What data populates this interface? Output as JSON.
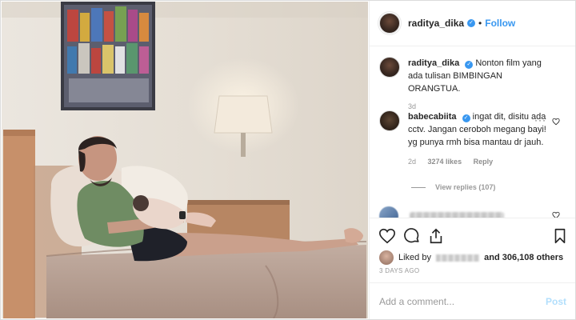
{
  "post": {
    "author": "raditya_dika",
    "follow_label": "Follow",
    "separator": "•",
    "verified_mark": "✓"
  },
  "caption": {
    "user": "raditya_dika",
    "text": "Nonton film yang ada tulisan BIMBINGAN ORANGTUA.",
    "age": "3d"
  },
  "comments": [
    {
      "user": "babecabiita",
      "text": "ingat dit, disitu ada cctv. Jangan ceroboh megang bayi! yg punya rmh bisa mantau dr jauh.",
      "age": "2d",
      "likes": "3274 likes",
      "reply_label": "Reply",
      "more_icon": "more-dots-icon",
      "heart_icon": "heart-outline-icon"
    }
  ],
  "view_replies": "View replies (107)",
  "actions": {
    "like_icon": "heart-outline-icon",
    "comment_icon": "comment-bubble-icon",
    "share_icon": "share-upload-icon",
    "save_icon": "bookmark-icon"
  },
  "likes": {
    "prefix": "Liked by",
    "suffix": "and 306,108 others"
  },
  "posted": "3 DAYS AGO",
  "composer": {
    "placeholder": "Add a comment...",
    "post_label": "Post"
  },
  "colors": {
    "accent": "#3897f0",
    "post_disabled": "#b2dffc",
    "muted": "#999999",
    "text": "#262626",
    "border": "#efefef"
  }
}
